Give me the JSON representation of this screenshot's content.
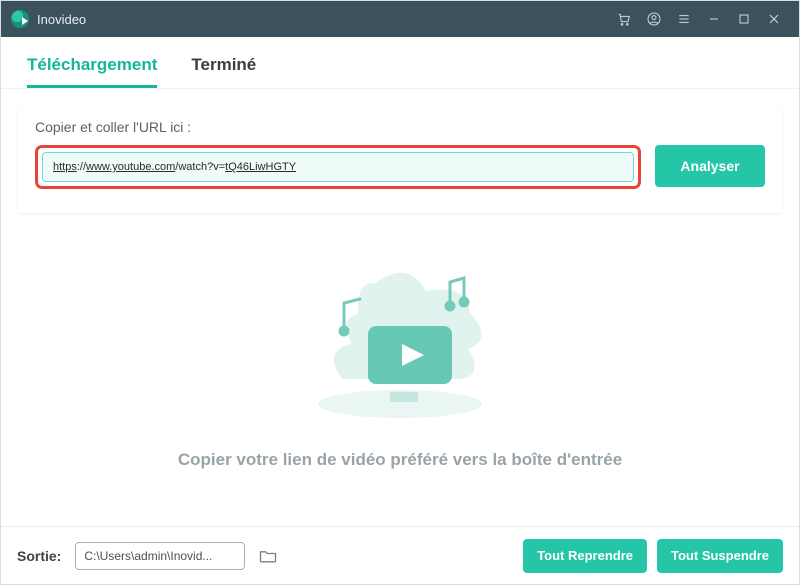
{
  "titlebar": {
    "app_name": "Inovideo"
  },
  "tabs": {
    "download": "Téléchargement",
    "finished": "Terminé"
  },
  "input_section": {
    "label": "Copier et coller l'URL ici :",
    "url_prefix": "https",
    "url_scheme_sep": "://",
    "url_domain": "www.youtube.com",
    "url_path": "/watch?v=",
    "url_videoid": "tQ46LiwHGTY",
    "analyze_button": "Analyser"
  },
  "hint_text": "Copier votre lien de vidéo préféré vers la boîte d'entrée",
  "footer": {
    "output_label": "Sortie:",
    "output_path": "C:\\Users\\admin\\Inovid...",
    "resume_all": "Tout Reprendre",
    "suspend_all": "Tout Suspendre"
  }
}
